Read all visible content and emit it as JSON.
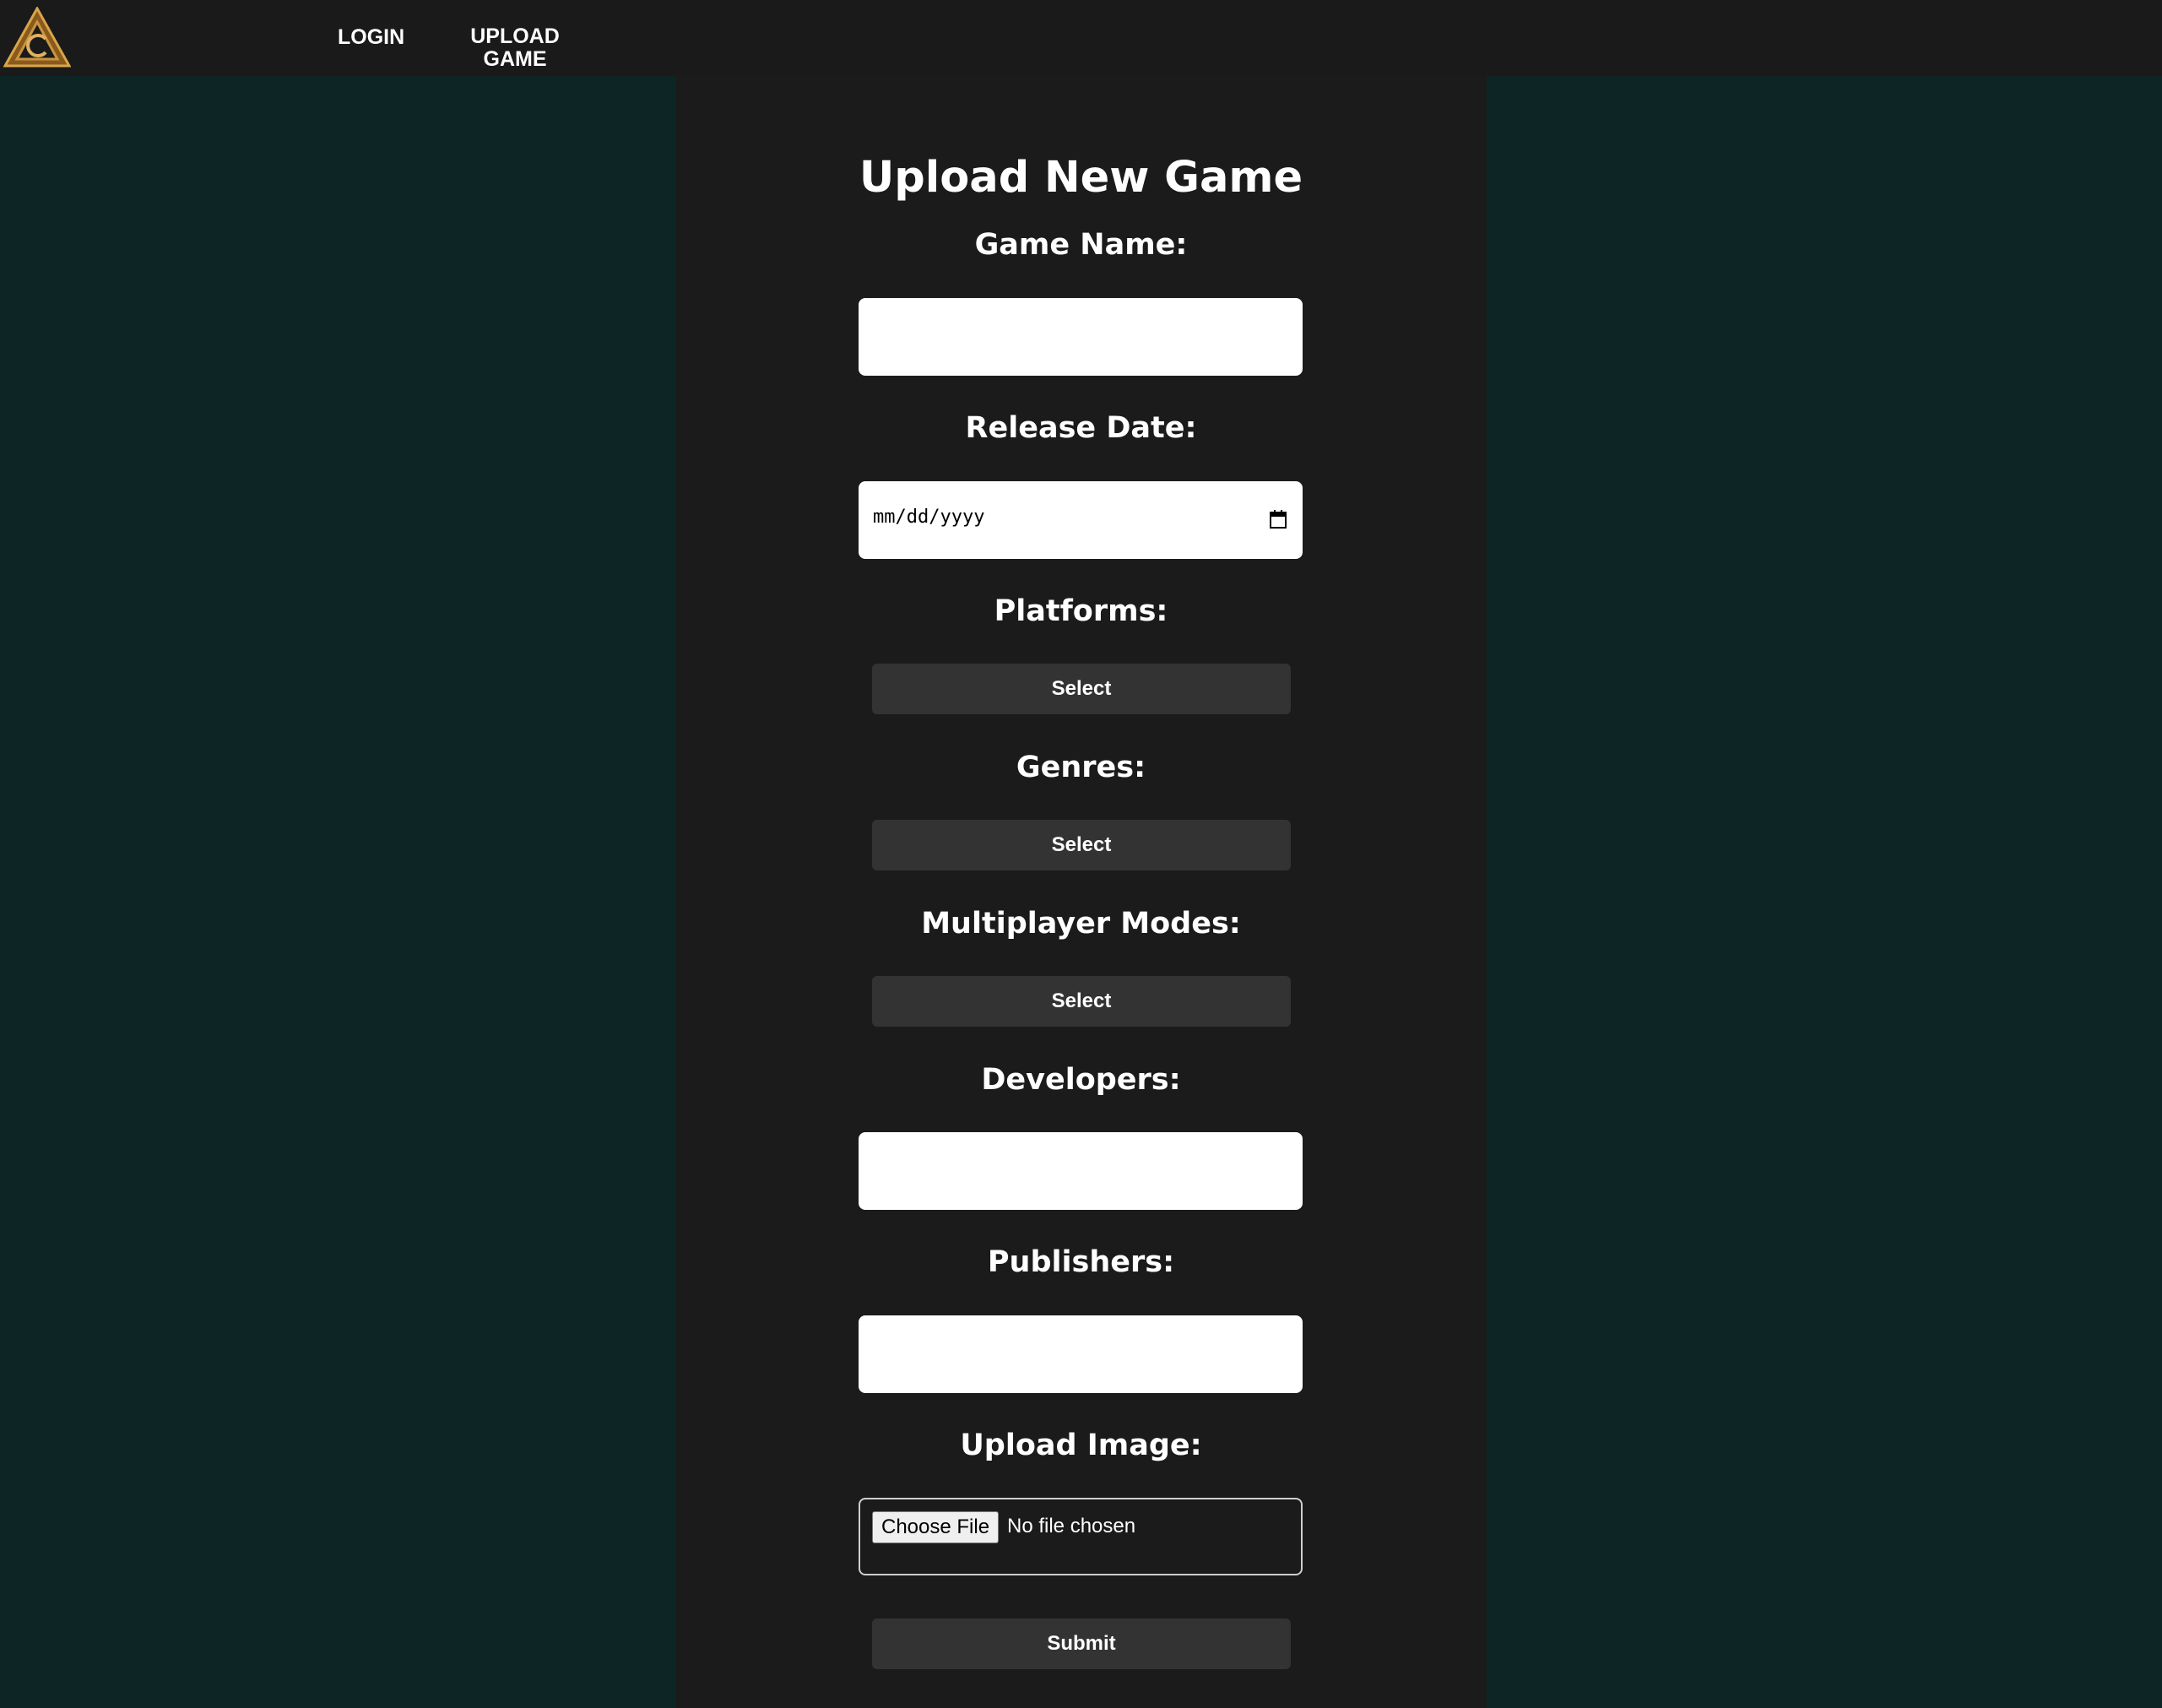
{
  "nav": {
    "logo_icon": "triangle-logo-icon",
    "login_label": "LOGIN",
    "upload_line1": "UPLOAD",
    "upload_line2": "GAME"
  },
  "form": {
    "title": "Upload New Game",
    "game_name_label": "Game Name:",
    "game_name_value": "",
    "release_date_label": "Release Date:",
    "release_date_placeholder": "mm/dd/yyyy",
    "platforms_label": "Platforms:",
    "platforms_select": "Select",
    "genres_label": "Genres:",
    "genres_select": "Select",
    "multiplayer_label": "Multiplayer Modes:",
    "multiplayer_select": "Select",
    "developers_label": "Developers:",
    "developers_value": "",
    "publishers_label": "Publishers:",
    "publishers_value": "",
    "upload_image_label": "Upload Image:",
    "choose_file_label": "Choose File",
    "no_file_text": "No file chosen",
    "submit_label": "Submit"
  },
  "colors": {
    "background": "#0d2524",
    "panel": "#1b1b1b",
    "navbar": "#1a1a1a",
    "button": "#333333",
    "logo_gold": "#c9953f"
  }
}
